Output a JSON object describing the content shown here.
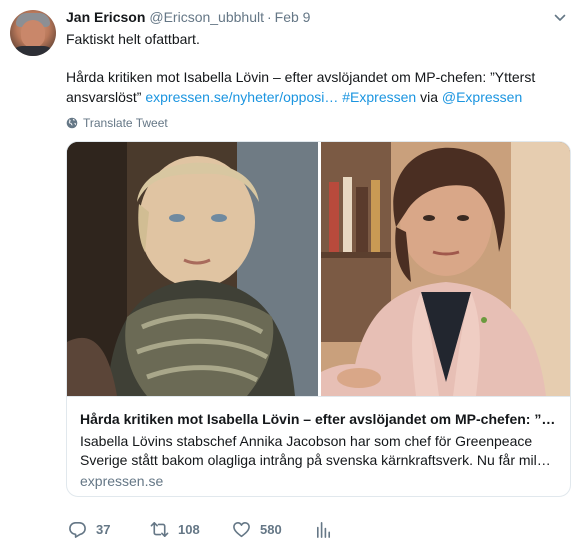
{
  "tweet": {
    "author_name": "Jan Ericson",
    "author_handle": "@Ericson_ubbhult",
    "separator": "·",
    "date": "Feb 9",
    "line1": "Faktiskt helt ofattbart.",
    "body_prefix": "Hårda kritiken mot Isabella Lövin – efter avslöjandet om MP-chefen: ”Ytterst ansvarslöst”",
    "body_link": "expressen.se/nyheter/opposi…",
    "body_hashtag": "#Expressen",
    "body_via": "via",
    "body_mention": "@Expressen",
    "translate_label": "Translate Tweet"
  },
  "card": {
    "title": "Hårda kritiken mot Isabella Lövin – efter avslöjandet om MP-chefen: ”…",
    "description": "Isabella Lövins stabschef Annika Jacobson har som chef för Greenpeace Sverige stått bakom olagliga intrång på svenska kärnkraftsverk. Nu får mil…",
    "domain": "expressen.se"
  },
  "actions": {
    "reply_count": "37",
    "retweet_count": "108",
    "like_count": "580"
  },
  "icons": {
    "chevron": "chevron-down-icon",
    "globe": "globe-icon",
    "reply": "reply-icon",
    "retweet": "retweet-icon",
    "like": "heart-icon",
    "analytics": "analytics-icon"
  },
  "colors": {
    "link": "#1b95e0",
    "muted": "#657786",
    "text": "#14171a",
    "border": "#e1e8ed"
  }
}
